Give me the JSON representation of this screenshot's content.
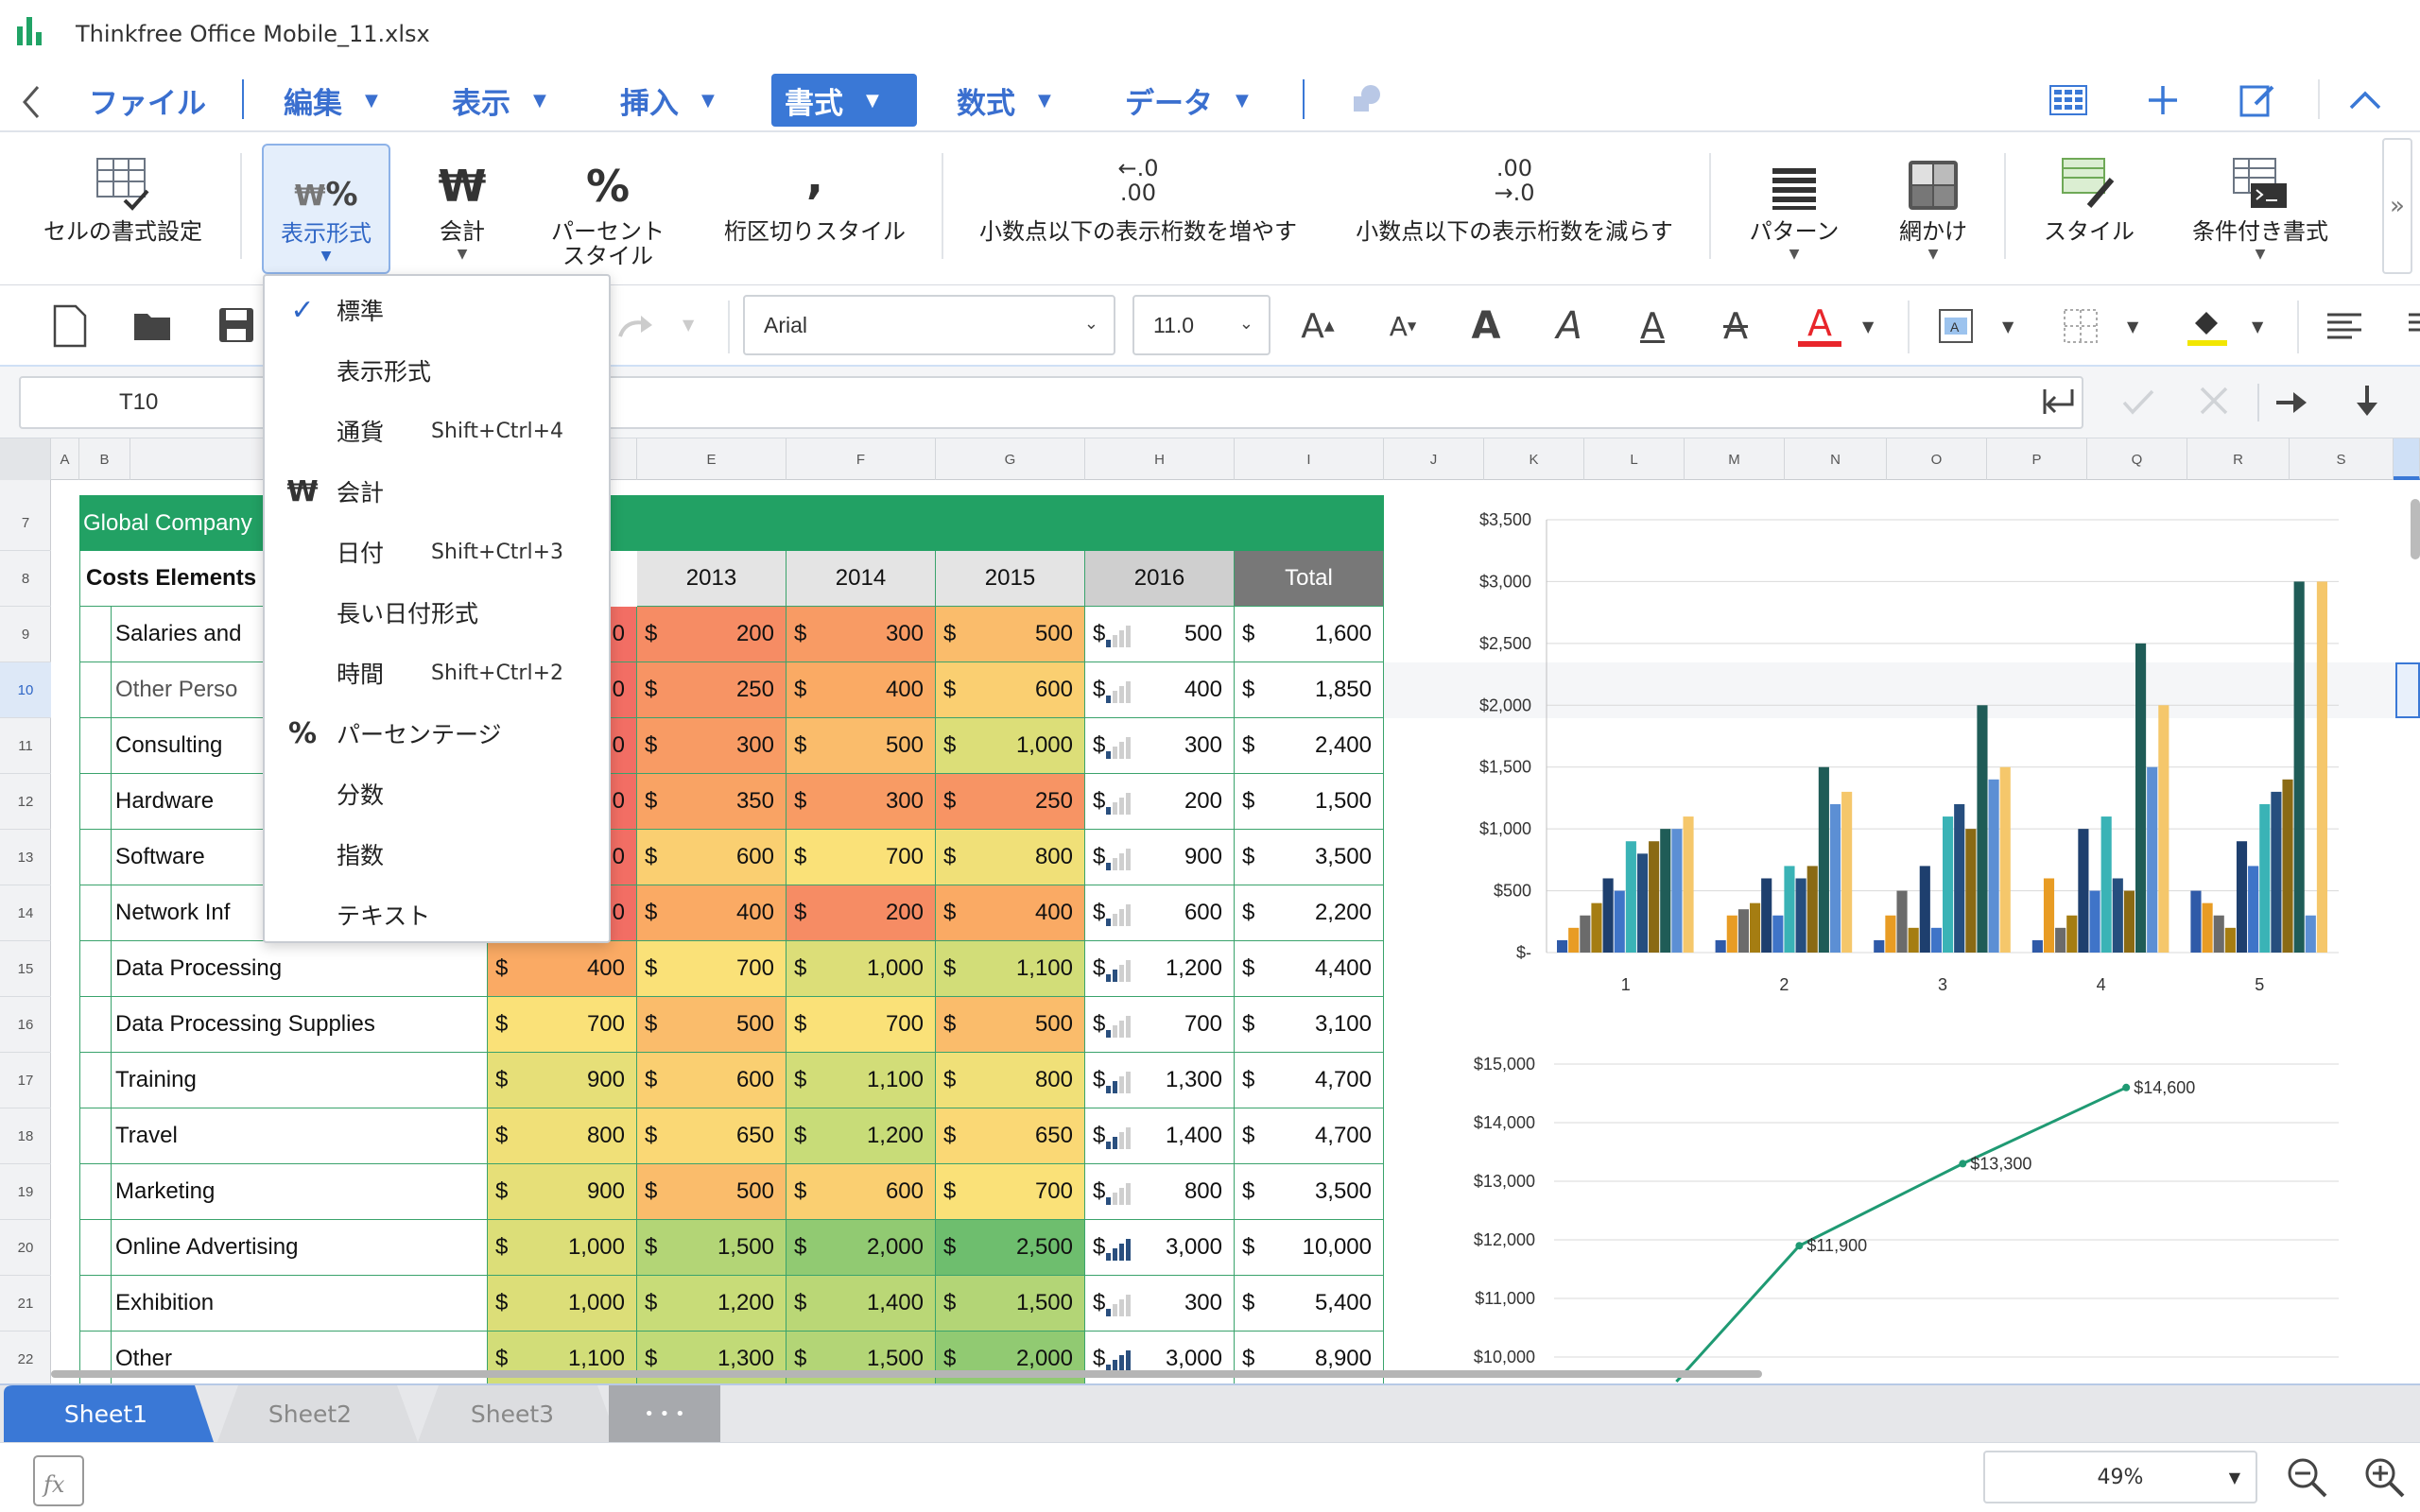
{
  "window": {
    "title": "Thinkfree Office Mobile_11.xlsx"
  },
  "menu": {
    "items": [
      {
        "label": "ファイル"
      },
      {
        "label": "編集"
      },
      {
        "label": "表示"
      },
      {
        "label": "挿入"
      },
      {
        "label": "書式"
      },
      {
        "label": "数式"
      },
      {
        "label": "データ"
      }
    ]
  },
  "ribbon": {
    "items": [
      {
        "label": "セルの書式設定"
      },
      {
        "label": "表示形式"
      },
      {
        "label": "会計"
      },
      {
        "label": "パーセント\nスタイル"
      },
      {
        "label": "桁区切りスタイル"
      },
      {
        "label": "小数点以下の表示桁数を増やす"
      },
      {
        "label": "小数点以下の表示桁数を減らす"
      },
      {
        "label": "パターン"
      },
      {
        "label": "網かけ"
      },
      {
        "label": "スタイル"
      },
      {
        "label": "条件付き書式"
      }
    ],
    "icons": {
      "won": "₩",
      "percent": "%",
      "comma": ",",
      "inc_top": "←.0",
      "inc_bot": ".00",
      "dec_top": ".00",
      "dec_bot": "→.0",
      "more": "»"
    }
  },
  "toolbar": {
    "font": "Arial",
    "size": "11.0",
    "letter": "A",
    "colors": {
      "font_color": "#e8262b",
      "fill_color": "#f2e600",
      "accent": "#3a78d6"
    }
  },
  "formula": {
    "cell_ref": "T10"
  },
  "columns": [
    "A",
    "B",
    "",
    "",
    "E",
    "F",
    "G",
    "H",
    "I",
    "J",
    "K",
    "L",
    "M",
    "N",
    "O",
    "P",
    "Q",
    "R",
    "S"
  ],
  "rows": [
    "7",
    "8",
    "9",
    "10",
    "11",
    "12",
    "13",
    "14",
    "15",
    "16",
    "17",
    "18",
    "19",
    "20",
    "21",
    "22"
  ],
  "sheet": {
    "company": "Global Company",
    "cost_header": "Costs Elements",
    "year_headers": [
      "2013",
      "2014",
      "2015",
      "2016",
      "Total"
    ],
    "currency": "$",
    "data": [
      {
        "label": "Salaries and",
        "c0": "0",
        "v2013": "200",
        "v2014": "300",
        "v2015": "500",
        "v2016": "500",
        "total": "1,600"
      },
      {
        "label": "Other Perso",
        "c0": "0",
        "v2013": "250",
        "v2014": "400",
        "v2015": "600",
        "v2016": "400",
        "total": "1,850"
      },
      {
        "label": "Consulting",
        "c0": "0",
        "v2013": "300",
        "v2014": "500",
        "v2015": "1,000",
        "v2016": "300",
        "total": "2,400"
      },
      {
        "label": "Hardware",
        "c0": "0",
        "v2013": "350",
        "v2014": "300",
        "v2015": "250",
        "v2016": "200",
        "total": "1,500"
      },
      {
        "label": "Software",
        "c0": "0",
        "v2013": "600",
        "v2014": "700",
        "v2015": "800",
        "v2016": "900",
        "total": "3,500"
      },
      {
        "label": "Network Inf",
        "c0": "0",
        "v2013": "400",
        "v2014": "200",
        "v2015": "400",
        "v2016": "600",
        "total": "2,200"
      },
      {
        "label": "Data Processing",
        "c0": "400",
        "v2013": "700",
        "v2014": "1,000",
        "v2015": "1,100",
        "v2016": "1,200",
        "total": "4,400"
      },
      {
        "label": "Data Processing Supplies",
        "c0": "700",
        "v2013": "500",
        "v2014": "700",
        "v2015": "500",
        "v2016": "700",
        "total": "3,100"
      },
      {
        "label": "Training",
        "c0": "900",
        "v2013": "600",
        "v2014": "1,100",
        "v2015": "800",
        "v2016": "1,300",
        "total": "4,700"
      },
      {
        "label": "Travel",
        "c0": "800",
        "v2013": "650",
        "v2014": "1,200",
        "v2015": "650",
        "v2016": "1,400",
        "total": "4,700"
      },
      {
        "label": "Marketing",
        "c0": "900",
        "v2013": "500",
        "v2014": "600",
        "v2015": "700",
        "v2016": "800",
        "total": "3,500"
      },
      {
        "label": "Online Advertising",
        "c0": "1,000",
        "v2013": "1,500",
        "v2014": "2,000",
        "v2015": "2,500",
        "v2016": "3,000",
        "total": "10,000"
      },
      {
        "label": "Exhibition",
        "c0": "1,000",
        "v2013": "1,200",
        "v2014": "1,400",
        "v2015": "1,500",
        "v2016": "300",
        "total": "5,400"
      },
      {
        "label": "Other",
        "c0": "1,100",
        "v2013": "1,300",
        "v2014": "1,500",
        "v2015": "2,000",
        "v2016": "3,000",
        "total": "8,900"
      }
    ]
  },
  "dropdown": {
    "items": [
      {
        "label": "標準",
        "icon": "✓",
        "shortcut": ""
      },
      {
        "label": "表示形式",
        "icon": "",
        "shortcut": ""
      },
      {
        "label": "通貨",
        "icon": "",
        "shortcut": "Shift+Ctrl+4"
      },
      {
        "label": "会計",
        "icon": "₩",
        "shortcut": ""
      },
      {
        "label": "日付",
        "icon": "",
        "shortcut": "Shift+Ctrl+3"
      },
      {
        "label": "長い日付形式",
        "icon": "",
        "shortcut": ""
      },
      {
        "label": "時間",
        "icon": "",
        "shortcut": "Shift+Ctrl+2"
      },
      {
        "label": "パーセンテージ",
        "icon": "%",
        "shortcut": ""
      },
      {
        "label": "分数",
        "icon": "",
        "shortcut": ""
      },
      {
        "label": "指数",
        "icon": "",
        "shortcut": ""
      },
      {
        "label": "テキスト",
        "icon": "",
        "shortcut": ""
      }
    ]
  },
  "tabs": {
    "sheets": [
      "Sheet1",
      "Sheet2",
      "Sheet3"
    ],
    "more": "• • •"
  },
  "status": {
    "zoom": "49%"
  },
  "chart_data": [
    {
      "type": "bar",
      "categories": [
        "1",
        "2",
        "3",
        "4",
        "5"
      ],
      "ylim": [
        0,
        3500
      ],
      "yticks": [
        "$-",
        "$500",
        "$1,000",
        "$1,500",
        "$2,000",
        "$2,500",
        "$3,000",
        "$3,500"
      ],
      "grid": true,
      "colors": [
        "#2f5aa8",
        "#e89c24",
        "#6b6b6b",
        "#a57d12",
        "#1e3f6e",
        "#3f74c8",
        "#3ab3b6",
        "#264e7e",
        "#8a6a14",
        "#1f5c57",
        "#5c8fd4",
        "#f5c76b"
      ],
      "series": [
        {
          "values": [
            100,
            100,
            100,
            100,
            500
          ]
        },
        {
          "values": [
            200,
            300,
            300,
            600,
            400
          ]
        },
        {
          "values": [
            300,
            350,
            500,
            200,
            300
          ]
        },
        {
          "values": [
            400,
            400,
            200,
            300,
            200
          ]
        },
        {
          "values": [
            600,
            600,
            700,
            1000,
            900
          ]
        },
        {
          "values": [
            500,
            300,
            200,
            500,
            700
          ]
        },
        {
          "values": [
            900,
            700,
            1100,
            1100,
            1200
          ]
        },
        {
          "values": [
            800,
            600,
            1200,
            600,
            1300
          ]
        },
        {
          "values": [
            900,
            700,
            1000,
            500,
            1400
          ]
        },
        {
          "values": [
            1000,
            1500,
            2000,
            2500,
            3000
          ]
        },
        {
          "values": [
            1000,
            1200,
            1400,
            1500,
            300
          ]
        },
        {
          "values": [
            1100,
            1300,
            1500,
            2000,
            3000
          ]
        }
      ]
    },
    {
      "type": "line",
      "ylim": [
        10000,
        15000
      ],
      "yticks": [
        "$10,000",
        "$11,000",
        "$12,000",
        "$13,000",
        "$14,000",
        "$15,000"
      ],
      "points": [
        {
          "x": 2,
          "y": 11900,
          "label": "$11,900"
        },
        {
          "x": 3,
          "y": 13300,
          "label": "$13,300"
        },
        {
          "x": 4,
          "y": 14600,
          "label": "$14,600"
        }
      ],
      "color": "#1f9a73",
      "grid": true
    }
  ]
}
